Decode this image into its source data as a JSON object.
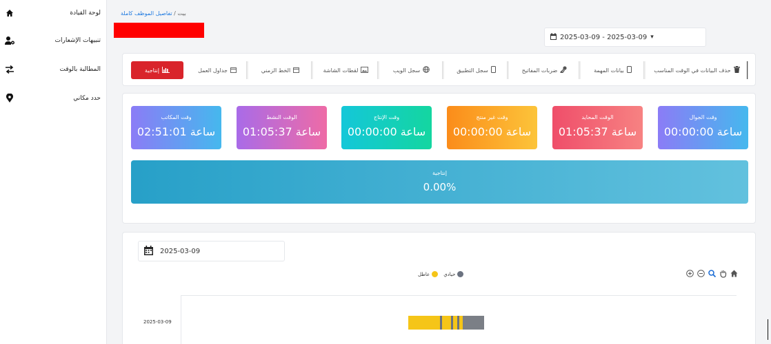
{
  "sidebar": {
    "items": [
      {
        "label": "لوحة القيادة",
        "icon": "home-icon"
      },
      {
        "label": "تنبيهات الإشعارات",
        "icon": "user-gear-icon"
      },
      {
        "label": "المطالبة بالوقت",
        "icon": "exchange-icon"
      },
      {
        "label": "حدد مكاني",
        "icon": "map-pin-icon"
      }
    ]
  },
  "breadcrumb": {
    "home": "بيت",
    "separator": "/",
    "current": "تفاصيل الموظف كاملة"
  },
  "date_range": {
    "value": "2025-03-09 - 2025-03-09",
    "icon": "calendar-icon",
    "caret": "▾"
  },
  "tabs": [
    {
      "label": "إنتاجية",
      "icon": "chart-icon",
      "active": true
    },
    {
      "label": "جداول العمل",
      "icon": "calendar-icon"
    },
    {
      "label": "الخط الزمني",
      "icon": "calendar-icon"
    },
    {
      "label": "لقطات الشاشة",
      "icon": "image-icon"
    },
    {
      "label": "سجل الويب",
      "icon": "globe-icon"
    },
    {
      "label": "سجل التطبيق",
      "icon": "mobile-icon"
    },
    {
      "label": "ضربات المفاتيح",
      "icon": "key-icon"
    },
    {
      "label": "بيانات المهمة",
      "icon": "mobile-icon"
    },
    {
      "label": "حذف البيانات في الوقت المناسب",
      "icon": "trash-icon"
    }
  ],
  "stats": [
    {
      "title": "وقت المكاتب",
      "value": "02:51:01 ساعة",
      "colors": [
        "#8b7cf6",
        "#45b8ee"
      ]
    },
    {
      "title": "الوقت النشط",
      "value": "01:05:37 ساعة",
      "colors": [
        "#a96be8",
        "#ee6ba6"
      ]
    },
    {
      "title": "وقت الإنتاج",
      "value": "00:00:00 ساعة",
      "colors": [
        "#14c7d9",
        "#14d6a0"
      ]
    },
    {
      "title": "وقت غير منتج",
      "value": "00:00:00 ساعة",
      "colors": [
        "#fb8c1a",
        "#fcc43a"
      ]
    },
    {
      "title": "الوقت المحايد",
      "value": "01:05:37 ساعة",
      "colors": [
        "#ef4e6a",
        "#f78282"
      ]
    },
    {
      "title": "وقت الجوال",
      "value": "00:00:00 ساعة",
      "colors": [
        "#8b7cf6",
        "#45b8ee"
      ]
    }
  ],
  "productivity": {
    "title": "إنتاجية",
    "value": "0.00%"
  },
  "timeline": {
    "date": "2025-03-09",
    "legend": [
      {
        "label": "عاطل",
        "color": "#f5c518"
      },
      {
        "label": "حيادي",
        "color": "#6b7280"
      }
    ],
    "row_label": "2025-03-09",
    "tools": [
      "zoom-in-icon",
      "zoom-out-icon",
      "magnifier-icon",
      "pan-hand-icon",
      "home-icon"
    ]
  },
  "chart_data": {
    "type": "timeline",
    "categories": [
      "2025-03-09"
    ],
    "segments": [
      {
        "category": "عاطل",
        "color": "#f5c518"
      },
      {
        "category": "حيادي",
        "color": "#6b7280"
      }
    ]
  }
}
